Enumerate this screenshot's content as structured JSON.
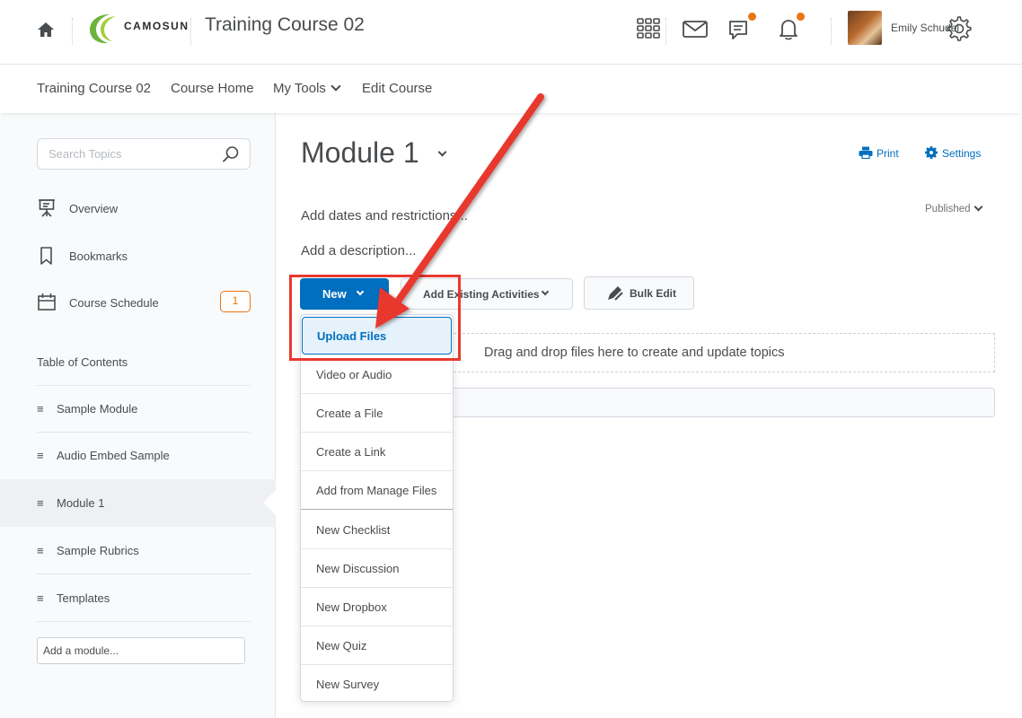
{
  "header": {
    "logo_text": "CAMOSUN",
    "course_title": "Training Course 02",
    "user_name": "Emily Schudel",
    "icons": [
      "home-icon",
      "apps-grid-icon",
      "mail-icon",
      "chat-icon",
      "bell-icon",
      "gear-icon"
    ],
    "accent_color": "#006fbf",
    "alert_color": "#e87511"
  },
  "nav": {
    "items": [
      "Training Course 02",
      "Course Home",
      "My Tools",
      "Edit Course"
    ]
  },
  "sidebar": {
    "search_placeholder": "Search Topics",
    "links": [
      {
        "label": "Overview",
        "icon": "presentation-icon"
      },
      {
        "label": "Bookmarks",
        "icon": "bookmark-icon"
      },
      {
        "label": "Course Schedule",
        "icon": "calendar-icon",
        "badge": "1"
      }
    ],
    "toc_title": "Table of Contents",
    "toc_items": [
      "Sample Module",
      "Audio Embed Sample",
      "Module 1",
      "Sample Rubrics",
      "Templates"
    ],
    "active_toc": "Module 1",
    "add_module_placeholder": "Add a module..."
  },
  "main": {
    "title": "Module 1",
    "print_label": "Print",
    "settings_label": "Settings",
    "add_dates": "Add dates and restrictions...",
    "add_description": "Add a description...",
    "status": "Published",
    "buttons": {
      "new": "New",
      "add_existing": "Add Existing Activities",
      "bulk_edit": "Bulk Edit"
    },
    "dropzone_text": "Drag and drop files here to create and update topics"
  },
  "new_menu": {
    "items": [
      "Upload Files",
      "Video or Audio",
      "Create a File",
      "Create a Link",
      "Add from Manage Files",
      "New Checklist",
      "New Discussion",
      "New Dropbox",
      "New Quiz",
      "New Survey"
    ],
    "selected": "Upload Files"
  },
  "annotation": {
    "color": "#e8392f"
  }
}
